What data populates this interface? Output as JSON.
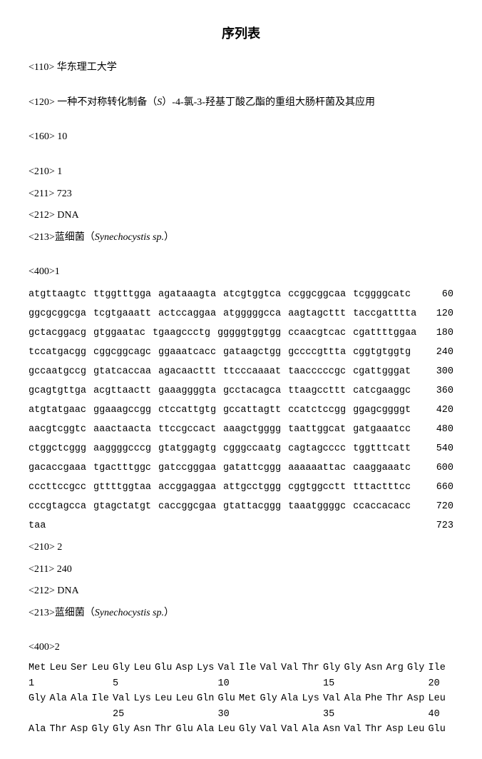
{
  "title": "序列表",
  "header": {
    "tag110": "<110> 华东理工大学",
    "tag120_prefix": "<120> 一种不对称转化制备（",
    "tag120_italic": "S",
    "tag120_suffix": "）-4-氯-3-羟基丁酸乙酯的重组大肠杆菌及其应用",
    "tag160": "<160> 10"
  },
  "seq1": {
    "tag210": "<210> 1",
    "tag211": "<211> 723",
    "tag212": "<212> DNA",
    "tag213_prefix": "<213>蓝细菌（",
    "tag213_italic": "Synechocystis sp.",
    "tag213_suffix": "）",
    "tag400": "<400>1",
    "rows": [
      {
        "g": [
          "atgttaagtc",
          "ttggtttgga",
          "agataaagta",
          "atcgtggtca",
          "ccggcggcaa",
          "tcggggcatc"
        ],
        "n": "60"
      },
      {
        "g": [
          "ggcgcggcga",
          "tcgtgaaatt",
          "actccaggaa",
          "atgggggcca",
          "aagtagcttt",
          "taccgatttta"
        ],
        "n": "120"
      },
      {
        "g": [
          "gctacggacg",
          "gtggaatac",
          "tgaagccctg",
          "gggggtggtgg",
          "ccaacgtcac",
          "cgattttggaa"
        ],
        "n": "180"
      },
      {
        "g": [
          "tccatgacgg",
          "cggcggcagc",
          "ggaaatcacc",
          "gataagctgg",
          "gccccgttta",
          "cggtgtggtg"
        ],
        "n": "240"
      },
      {
        "g": [
          "gccaatgccg",
          "gtatcaccaa",
          "agacaacttt",
          "ttcccaaaat",
          "taacccccgc",
          "cgattgggat"
        ],
        "n": "300"
      },
      {
        "g": [
          "gcagtgttga",
          "acgttaactt",
          "gaaaggggta",
          "gcctacagca",
          "ttaagccttt",
          "catcgaaggc"
        ],
        "n": "360"
      },
      {
        "g": [
          "atgtatgaac",
          "ggaaagccgg",
          "ctccattgtg",
          "gccattagtt",
          "ccatctccgg",
          "ggagcggggt"
        ],
        "n": "420"
      },
      {
        "g": [
          "aacgtcggtc",
          "aaactaacta",
          "ttccgccact",
          "aaagctgggg",
          "taattggcat",
          "gatgaaatcc"
        ],
        "n": "480"
      },
      {
        "g": [
          "ctggctcggg",
          "aaggggcccg",
          "gtatggagtg",
          "cgggccaatg",
          "cagtagcccc",
          "tggtttcatt"
        ],
        "n": "540"
      },
      {
        "g": [
          "gacaccgaaa",
          "tgactttggc",
          "gatccgggaa",
          "gatattcggg",
          "aaaaaattac",
          "caaggaaatc"
        ],
        "n": "600"
      },
      {
        "g": [
          "cccttccgcc",
          "gttttggtaa",
          "accggaggaa",
          "attgcctggg",
          "cggtggcctt",
          "tttactttcc"
        ],
        "n": "660"
      },
      {
        "g": [
          "cccgtagcca",
          "gtagctatgt",
          "caccggcgaa",
          "gtattacggg",
          "taaatggggc",
          "ccaccacacc"
        ],
        "n": "720"
      },
      {
        "g": [
          "taa",
          "",
          "",
          "",
          "",
          ""
        ],
        "n": "723"
      }
    ]
  },
  "seq2": {
    "tag210": "<210> 2",
    "tag211": "<211> 240",
    "tag212": "<212> DNA",
    "tag213_prefix": "<213>蓝细菌（",
    "tag213_italic": "Synechocystis sp.",
    "tag213_suffix": "）",
    "tag400": "<400>2",
    "protein_rows": [
      {
        "aa": [
          "Met",
          "Leu",
          "Ser",
          "Leu",
          "Gly",
          "Leu",
          "Glu",
          "Asp",
          "Lys",
          "Val",
          "Ile",
          "Val",
          "Val",
          "Thr",
          "Gly",
          "Gly",
          "Asn",
          "Arg",
          "Gly",
          "Ile"
        ],
        "nums": {
          "0": "1",
          "4": "5",
          "9": "10",
          "14": "15",
          "19": "20"
        }
      },
      {
        "aa": [
          "Gly",
          "Ala",
          "Ala",
          "Ile",
          "Val",
          "Lys",
          "Leu",
          "Leu",
          "Gln",
          "Glu",
          "Met",
          "Gly",
          "Ala",
          "Lys",
          "Val",
          "Ala",
          "Phe",
          "Thr",
          "Asp",
          "Leu"
        ],
        "nums": {
          "4": "25",
          "9": "30",
          "14": "35",
          "19": "40"
        }
      },
      {
        "aa": [
          "Ala",
          "Thr",
          "Asp",
          "Gly",
          "Gly",
          "Asn",
          "Thr",
          "Glu",
          "Ala",
          "Leu",
          "Gly",
          "Val",
          "Val",
          "Ala",
          "Asn",
          "Val",
          "Thr",
          "Asp",
          "Leu",
          "Glu"
        ],
        "nums": {}
      }
    ]
  }
}
